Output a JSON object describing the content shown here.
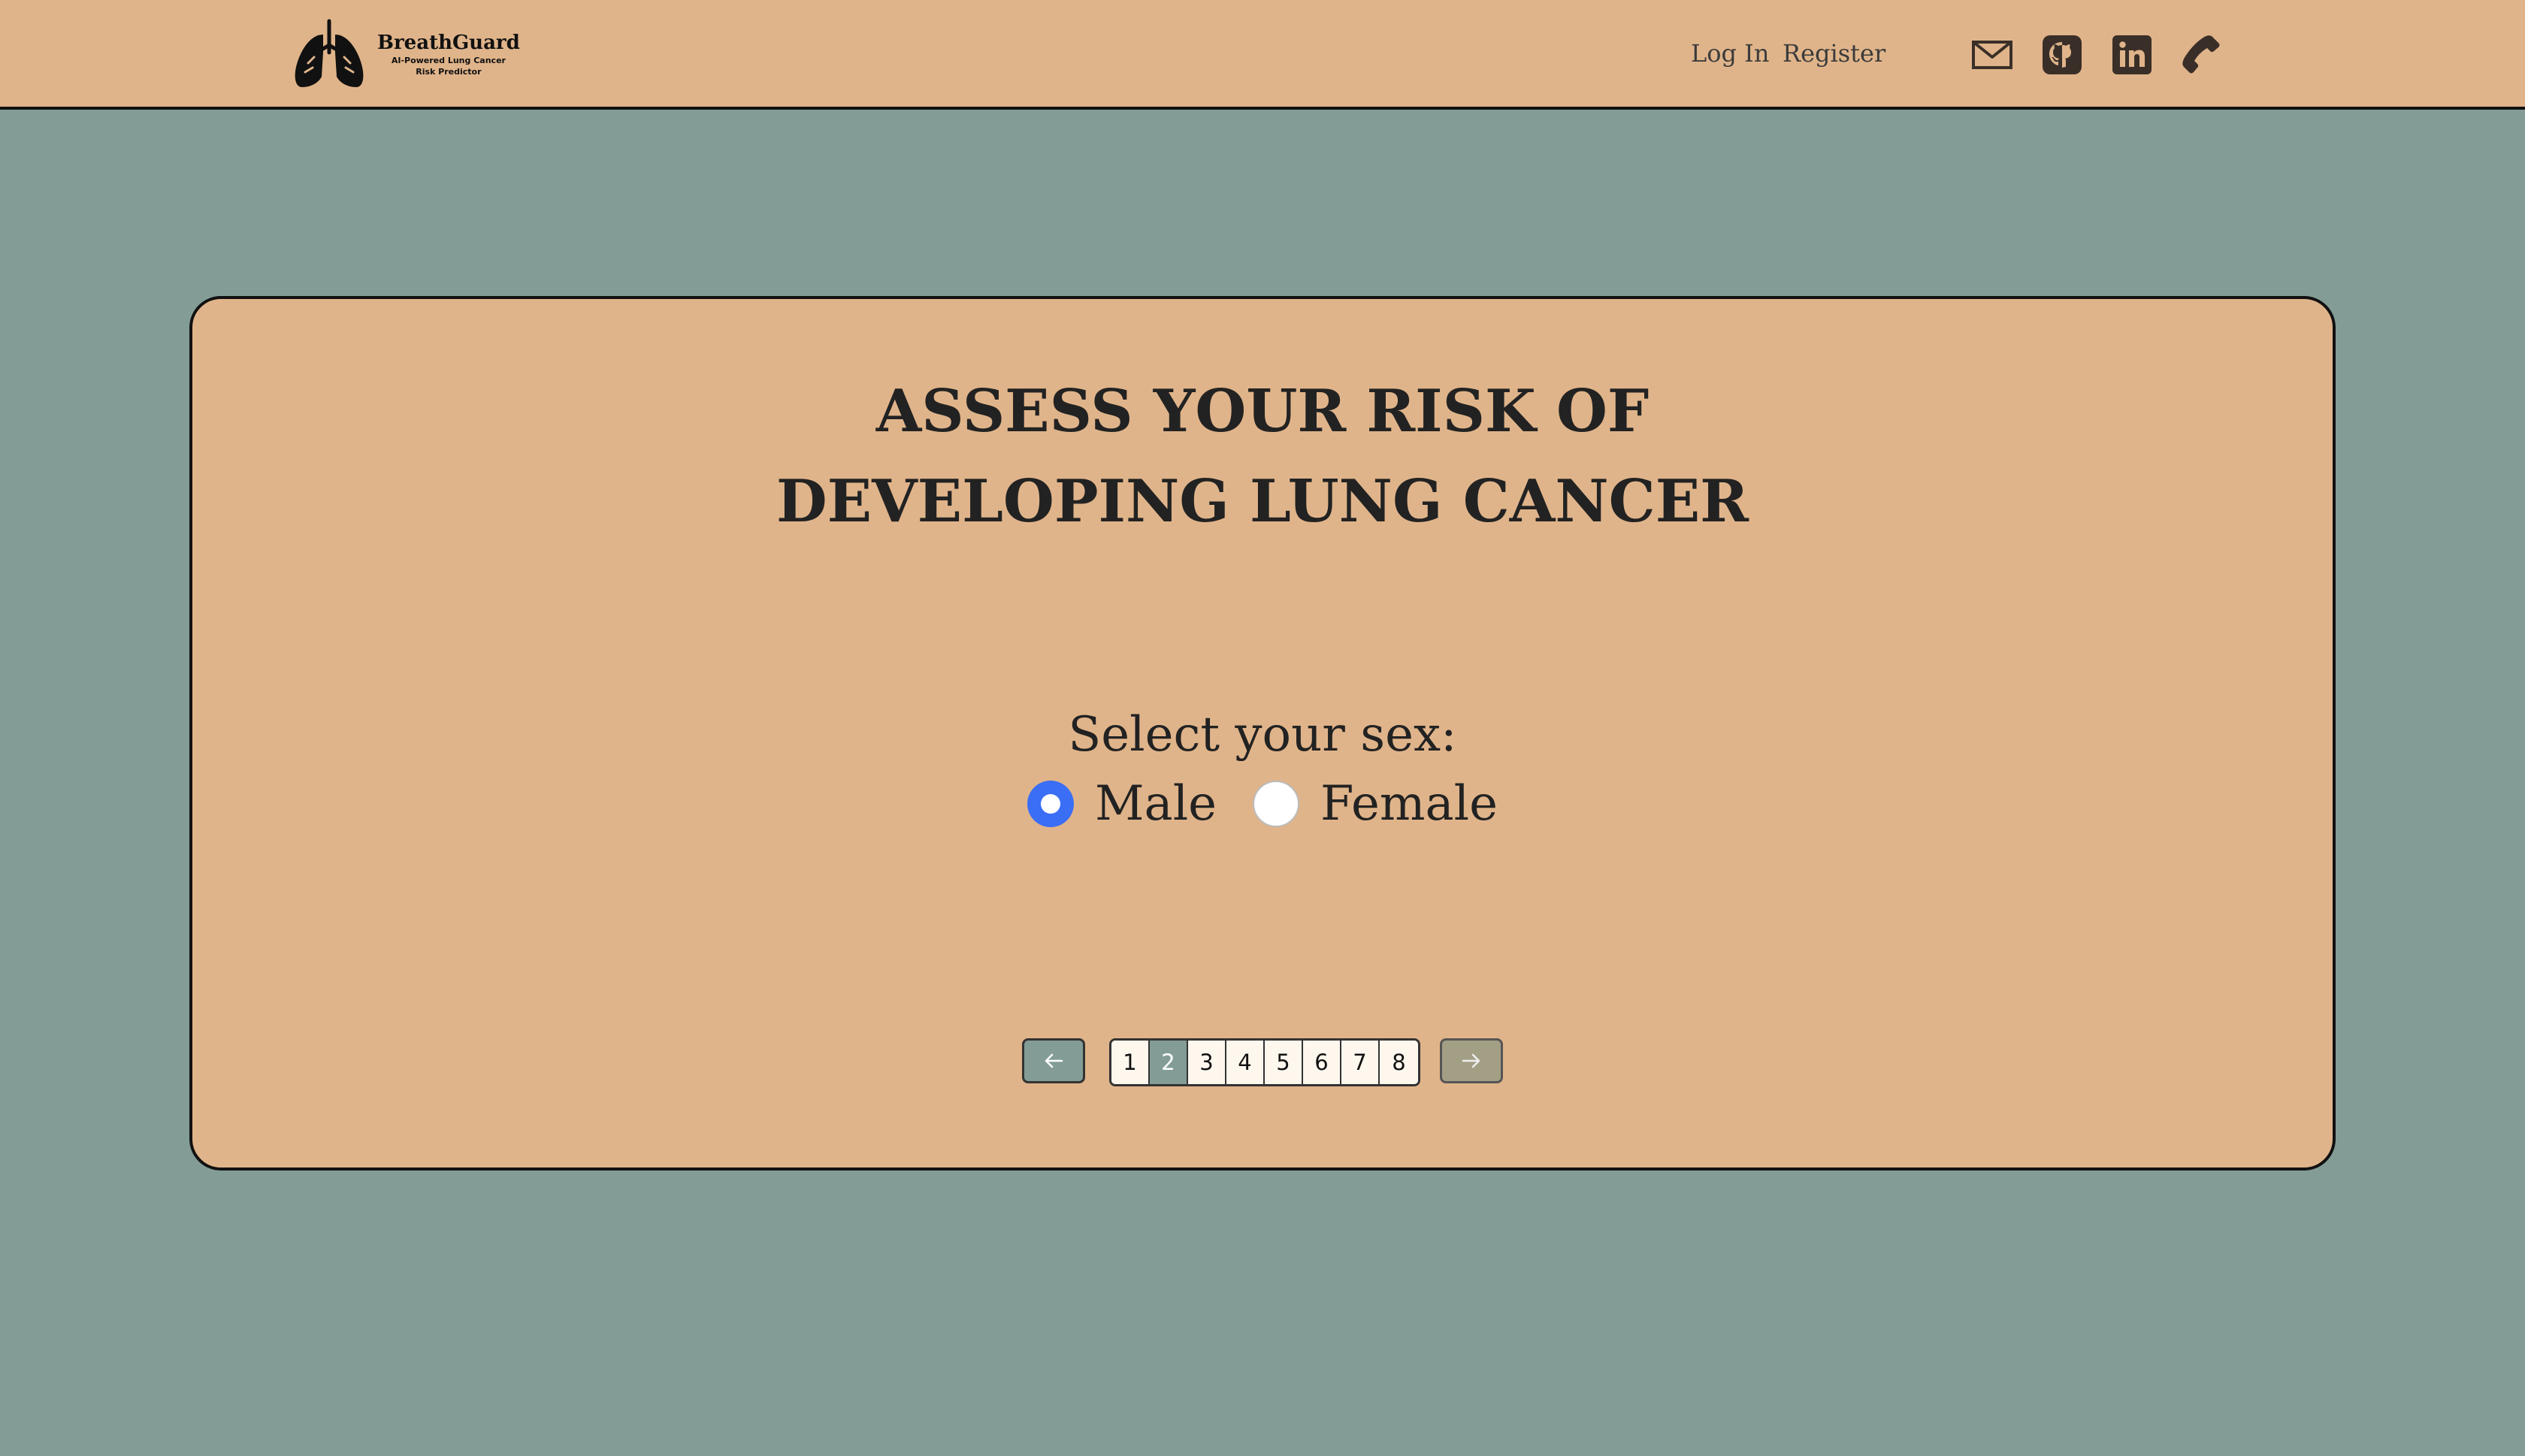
{
  "header": {
    "logo": {
      "name": "BreathGuard",
      "tagline_line1": "AI-Powered Lung Cancer",
      "tagline_line2": "Risk Predictor",
      "icon": "lungs-icon"
    },
    "nav": {
      "login": "Log In",
      "register": "Register"
    },
    "social": [
      {
        "name": "mail",
        "icon": "mail-icon"
      },
      {
        "name": "github",
        "icon": "github-icon"
      },
      {
        "name": "linkedin",
        "icon": "linkedin-icon"
      },
      {
        "name": "phone",
        "icon": "phone-icon"
      }
    ]
  },
  "card": {
    "title": "ASSESS YOUR RISK OF DEVELOPING LUNG CANCER",
    "question": "Select your sex:",
    "options": [
      {
        "label": "Male",
        "selected": true
      },
      {
        "label": "Female",
        "selected": false
      }
    ]
  },
  "pagination": {
    "prev_icon": "arrow-left-icon",
    "next_icon": "arrow-right-icon",
    "pages": [
      "1",
      "2",
      "3",
      "4",
      "5",
      "6",
      "7",
      "8"
    ],
    "current": "2"
  },
  "colors": {
    "background": "#839d96",
    "surface": "#e0b48a",
    "radio_selected": "#3a6ef5",
    "page_active": "#839d96"
  }
}
